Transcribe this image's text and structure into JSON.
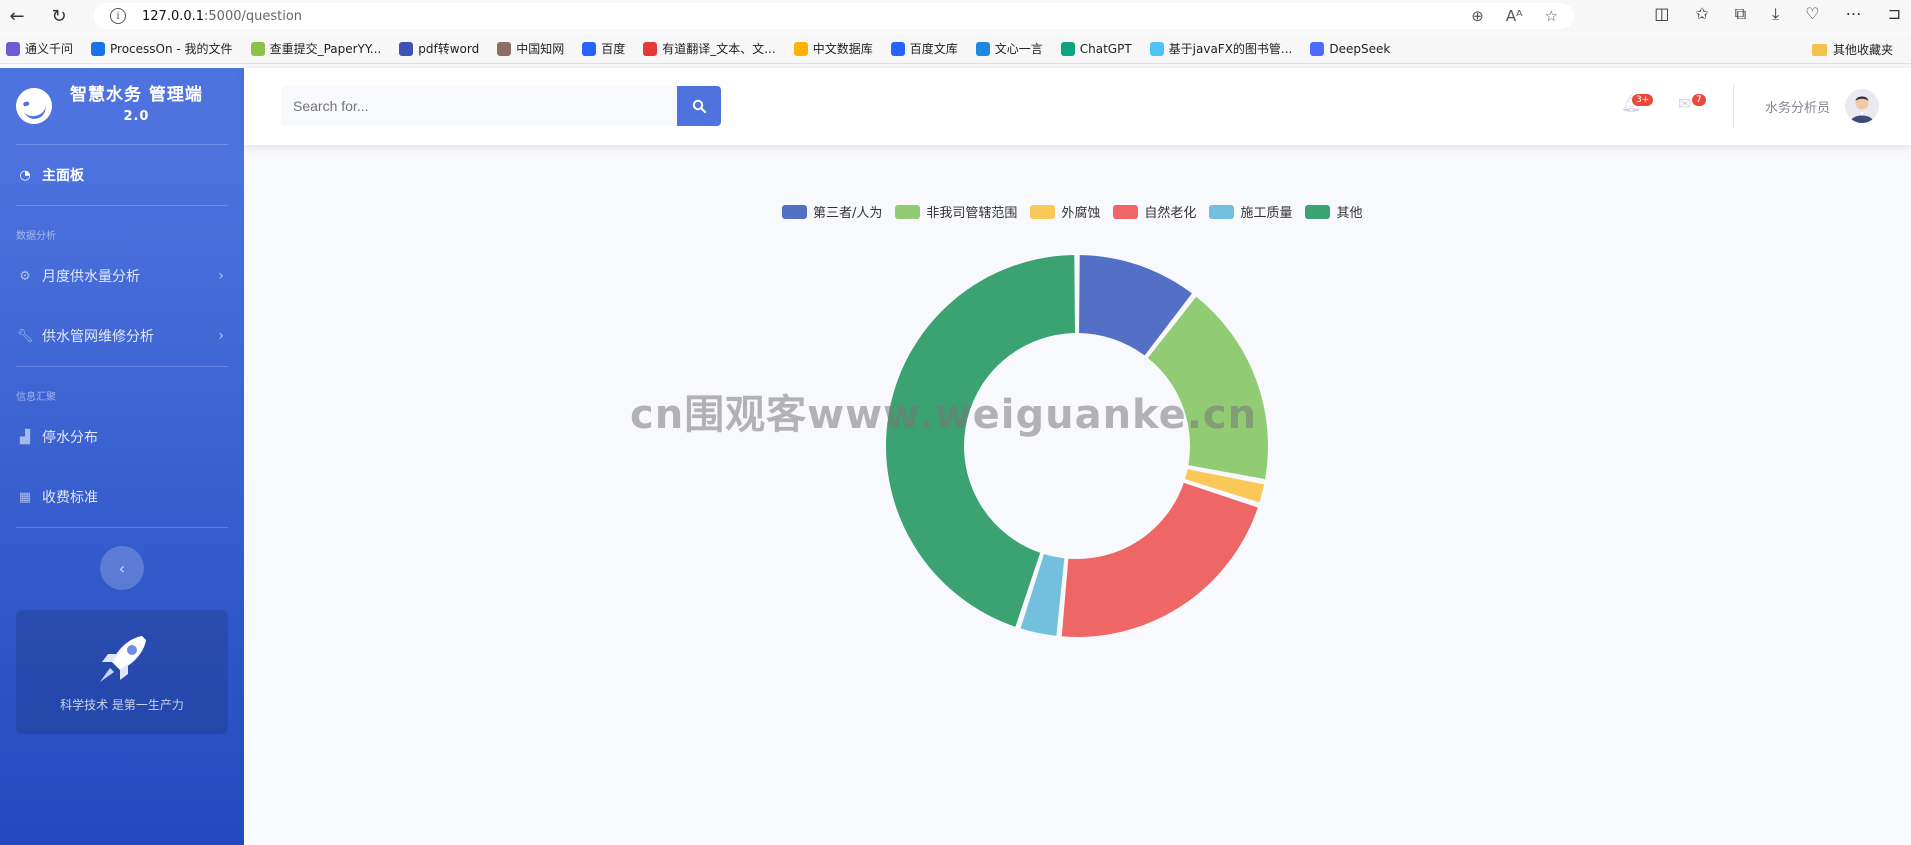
{
  "browser": {
    "url_host": "127.0.0.1",
    "url_path": ":5000/question",
    "bookmarks": [
      {
        "label": "通义千问",
        "color": "#6b5bd6"
      },
      {
        "label": "ProcessOn - 我的文件",
        "color": "#1a73e8"
      },
      {
        "label": "查重提交_PaperYY...",
        "color": "#8bc34a"
      },
      {
        "label": "pdf转word",
        "color": "#3f51b5"
      },
      {
        "label": "中国知网",
        "color": "#8d6e63"
      },
      {
        "label": "百度",
        "color": "#2962ff"
      },
      {
        "label": "有道翻译_文本、文...",
        "color": "#e53935"
      },
      {
        "label": "中文数据库",
        "color": "#ffb300"
      },
      {
        "label": "百度文库",
        "color": "#2962ff"
      },
      {
        "label": "文心一言",
        "color": "#1e88e5"
      },
      {
        "label": "ChatGPT",
        "color": "#10a37f"
      },
      {
        "label": "基于javaFX的图书管...",
        "color": "#4fc3f7"
      },
      {
        "label": "DeepSeek",
        "color": "#4d6bfe"
      }
    ],
    "other_bookmarks": "其他收藏夹"
  },
  "sidebar": {
    "brand_title": "智慧水务 管理端",
    "brand_version": "2.0",
    "dashboard": "主面板",
    "section_data": "数据分析",
    "item_monthly": "月度供水量分析",
    "item_repair": "供水管网维修分析",
    "section_info": "信息汇聚",
    "item_outage": "停水分布",
    "item_fee": "收费标准",
    "promo_text": "科学技术 是第一生产力"
  },
  "topbar": {
    "search_placeholder": "Search for...",
    "alerts_badge": "3+",
    "messages_badge": "7",
    "user_name": "水务分析员"
  },
  "watermark": "cn围观客www.weiguanke.cn",
  "chart_data": {
    "type": "pie",
    "variant": "donut",
    "series": [
      {
        "name": "第三者/人为",
        "value": 10.5,
        "color": "#5470c6"
      },
      {
        "name": "非我司管辖范围",
        "value": 17.5,
        "color": "#91cc75"
      },
      {
        "name": "外腐蚀",
        "value": 2.0,
        "color": "#fac858"
      },
      {
        "name": "自然老化",
        "value": 21.5,
        "color": "#ee6666"
      },
      {
        "name": "施工质量",
        "value": 3.5,
        "color": "#73c0de"
      },
      {
        "name": "其他",
        "value": 45.0,
        "color": "#3ba272"
      }
    ],
    "legend_position": "top-center"
  }
}
